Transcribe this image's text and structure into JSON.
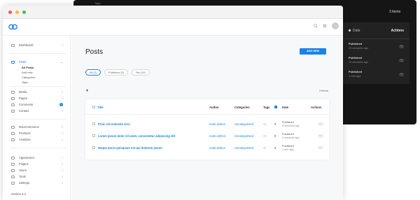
{
  "background_window": {
    "tags_label": "Tags",
    "items_count": "3 items",
    "table": {
      "date_header": "Date",
      "actions_header": "Actions",
      "rows": [
        {
          "status": "Published",
          "time": "23 seconds ago"
        },
        {
          "status": "Published",
          "time": "10 seconds ago"
        },
        {
          "status": "Published",
          "time": "1 min ago"
        }
      ]
    }
  },
  "window": {
    "dot_colors": [
      "#f25b4f",
      "#f6b73c",
      "#3fc34f"
    ]
  },
  "topbar": {
    "search_icon": "search-icon",
    "settings_icon": "gear-icon"
  },
  "sidebar": {
    "dashboard": "Dashboard",
    "posts": "Posts",
    "posts_sub": [
      "All Posts",
      "Add new",
      "Categories",
      "Tags"
    ],
    "group2": [
      "Media",
      "Pages",
      "Comments",
      "Contact"
    ],
    "comments_badge": "1",
    "group3": [
      "WooCommerce",
      "Products",
      "Analytics"
    ],
    "group4": [
      "Appearance",
      "Plugins",
      "Users",
      "Tools",
      "Settings"
    ],
    "version": "Version 5.4"
  },
  "main": {
    "title": "Posts",
    "add_new_label": "ADD NEW",
    "tabs": [
      "All (3)",
      "Published (3)",
      "Bin (10)"
    ],
    "items_count": "3 items",
    "columns": {
      "title": "Title",
      "author": "Author",
      "categories": "Categories",
      "tags": "Tags",
      "date": "Date",
      "actions": "Actions"
    },
    "rows": [
      {
        "title": "Proin vel molestie arcu",
        "author": "mark.ashton",
        "category": "Uncategorised",
        "tags": "—",
        "comments": "0",
        "status": "Published",
        "time": "4 seconds ago"
      },
      {
        "title": "Lorem ipsum dolor sit amet, consectetur adipiscing elit",
        "author": "mark.ashton",
        "category": "Uncategorised",
        "tags": "—",
        "comments": "0",
        "status": "Published",
        "time": "2 seconds ago"
      },
      {
        "title": "Neque porro quisquam est qui dolorem ipsum",
        "author": "mark.ashton",
        "category": "Uncategorised",
        "tags": "—",
        "comments": "0",
        "status": "Published",
        "time": "1 min ago"
      }
    ]
  }
}
